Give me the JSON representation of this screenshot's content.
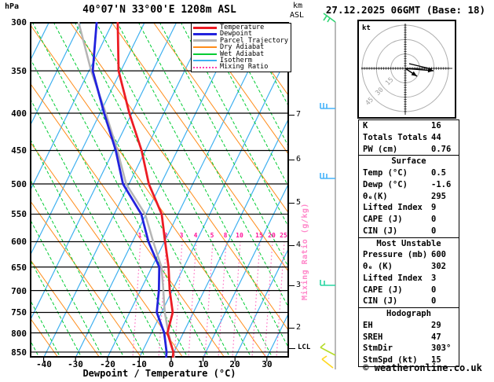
{
  "header": {
    "pressure_unit": "hPa",
    "title": "40°07'N 33°00'E 1208m ASL",
    "alt_unit_top": "km",
    "alt_unit_bottom": "ASL",
    "datetime": "27.12.2025 06GMT (Base: 18)"
  },
  "legend": {
    "items": [
      {
        "label": "Temperature",
        "color": "#ec1c24",
        "style": "solid-thick"
      },
      {
        "label": "Dewpoint",
        "color": "#2222dd",
        "style": "solid-thick"
      },
      {
        "label": "Parcel Trajectory",
        "color": "#b5b5b5",
        "style": "solid-thick"
      },
      {
        "label": "Dry Adiabat",
        "color": "#ff8c1a",
        "style": "solid-thin"
      },
      {
        "label": "Wet Adiabat",
        "color": "#00cc33",
        "style": "solid-thin"
      },
      {
        "label": "Isotherm",
        "color": "#3fb0f0",
        "style": "solid-thin"
      },
      {
        "label": "Mixing Ratio",
        "color": "#ff3fae",
        "style": "dotted"
      }
    ]
  },
  "axes": {
    "pressure_ticks": [
      "300",
      "350",
      "400",
      "450",
      "500",
      "550",
      "600",
      "650",
      "700",
      "750",
      "800",
      "850"
    ],
    "temp_ticks": [
      "-40",
      "-30",
      "-20",
      "-10",
      "0",
      "10",
      "20",
      "30"
    ],
    "xlabel": "Dewpoint / Temperature (°C)",
    "km_ticks": [
      "7",
      "6",
      "5",
      "4",
      "3",
      "2"
    ],
    "lcl_label": "LCL",
    "mixing_axis_label": "Mixing Ratio (g/kg)",
    "mixing_ratio_values": [
      "1",
      "2",
      "3",
      "4",
      "5",
      "8",
      "10",
      "15",
      "20",
      "25"
    ]
  },
  "hodograph": {
    "unit": "kt",
    "ring_labels": [
      "15",
      "30",
      "45"
    ]
  },
  "wind_barbs": [
    {
      "name": "barb-300hpa",
      "color": "#2fd573"
    },
    {
      "name": "barb-400hpa",
      "color": "#45b3fa"
    },
    {
      "name": "barb-500hpa",
      "color": "#45b3fa"
    },
    {
      "name": "barb-650hpa",
      "color": "#28d6a2"
    },
    {
      "name": "barb-850hpa",
      "color": "#b5dc2a"
    },
    {
      "name": "barb-surface",
      "color": "#ffd81e"
    }
  ],
  "table": {
    "sections": [
      {
        "header": "",
        "rows": [
          [
            "K",
            "16"
          ],
          [
            "Totals Totals",
            "44"
          ],
          [
            "PW (cm)",
            "0.76"
          ]
        ]
      },
      {
        "header": "Surface",
        "rows": [
          [
            "Temp (°C)",
            "0.5"
          ],
          [
            "Dewp (°C)",
            "-1.6"
          ],
          [
            "θₑ(K)",
            "295"
          ],
          [
            "Lifted Index",
            "9"
          ],
          [
            "CAPE (J)",
            "0"
          ],
          [
            "CIN (J)",
            "0"
          ]
        ]
      },
      {
        "header": "Most Unstable",
        "rows": [
          [
            "Pressure (mb)",
            "600"
          ],
          [
            "θₑ (K)",
            "302"
          ],
          [
            "Lifted Index",
            "3"
          ],
          [
            "CAPE (J)",
            "0"
          ],
          [
            "CIN (J)",
            "0"
          ]
        ]
      },
      {
        "header": "Hodograph",
        "rows": [
          [
            "EH",
            "29"
          ],
          [
            "SREH",
            "47"
          ],
          [
            "StmDir",
            "303°"
          ],
          [
            "StmSpd (kt)",
            "15"
          ]
        ]
      }
    ]
  },
  "footer": "© weatheronline.co.uk",
  "chart_data": {
    "type": "skewt-log-p-sounding",
    "location": "40°07'N 33°00'E 1208m ASL",
    "valid": "27.12.2025 06GMT (Base: 18)",
    "x_axis": {
      "label": "Dewpoint / Temperature (°C)",
      "range": [
        -45,
        37
      ],
      "ticks": [
        -40,
        -30,
        -20,
        -10,
        0,
        10,
        20,
        30
      ]
    },
    "y_axis": {
      "label": "hPa",
      "scale": "log",
      "range": [
        865,
        300
      ],
      "ticks": [
        300,
        350,
        400,
        450,
        500,
        550,
        600,
        650,
        700,
        750,
        800,
        850
      ]
    },
    "levels_hPa": [
      865,
      850,
      800,
      750,
      700,
      650,
      600,
      550,
      500,
      450,
      400,
      350,
      300
    ],
    "series": [
      {
        "name": "Temperature",
        "values_C": [
          0.5,
          -0.2,
          -5.0,
          -6.5,
          -10.8,
          -14.8,
          -19.8,
          -25.1,
          -33.8,
          -41.2,
          -50.8,
          -60.7,
          -68.5
        ]
      },
      {
        "name": "Dewpoint",
        "values_C": [
          -1.6,
          -2.3,
          -6.0,
          -11.5,
          -14.2,
          -17.7,
          -25.0,
          -31.5,
          -41.9,
          -49.3,
          -58.7,
          -68.8,
          -75.1
        ]
      },
      {
        "name": "Parcel Trajectory",
        "values_C": [
          1.0,
          -0.2,
          -4.7,
          -9.0,
          -12.8,
          -17.0,
          -23.5,
          -30.3,
          -40.9,
          -48.8,
          -58.2,
          -69.3,
          -80.8
        ]
      }
    ],
    "mixing_ratio_lines_gkg": [
      1,
      2,
      3,
      4,
      5,
      8,
      10,
      15,
      20,
      25
    ],
    "km_asl_marks": [
      7,
      6,
      5,
      4,
      3,
      2
    ],
    "lcl": "LCL near 860 hPa",
    "indices": {
      "K": 16,
      "TotalsTotals": 44,
      "PW_cm": 0.76,
      "surface": {
        "Temp_C": 0.5,
        "Dewp_C": -1.6,
        "ThetaE_K": 295,
        "LiftedIndex": 9,
        "CAPE_J": 0,
        "CIN_J": 0
      },
      "most_unstable": {
        "Pressure_mb": 600,
        "ThetaE_K": 302,
        "LiftedIndex": 3,
        "CAPE_J": 0,
        "CIN_J": 0
      },
      "hodograph": {
        "EH": 29,
        "SREH": 47,
        "StmDir_deg": 303,
        "StmSpd_kt": 15
      }
    }
  }
}
